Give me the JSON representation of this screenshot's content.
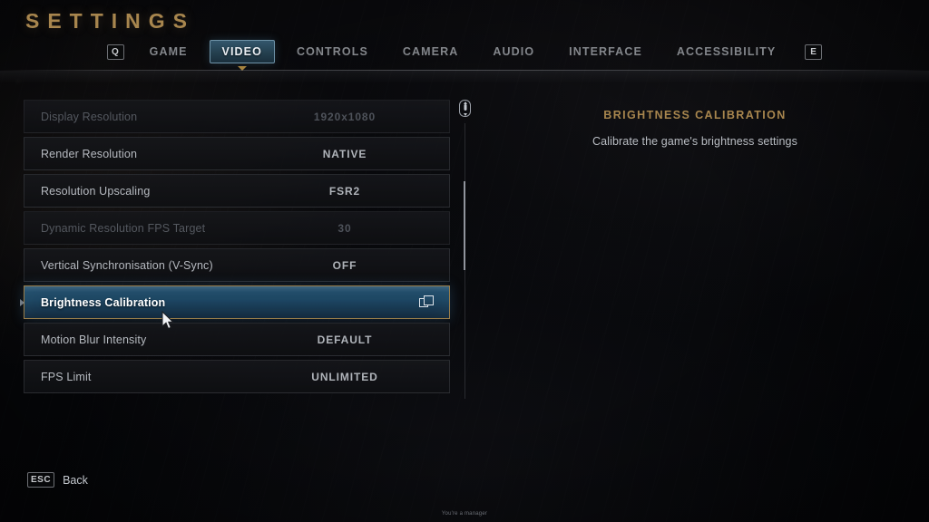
{
  "header": {
    "title": "SETTINGS"
  },
  "tabs": {
    "prev_key": "Q",
    "next_key": "E",
    "items": [
      {
        "label": "GAME",
        "active": false
      },
      {
        "label": "VIDEO",
        "active": true
      },
      {
        "label": "CONTROLS",
        "active": false
      },
      {
        "label": "CAMERA",
        "active": false
      },
      {
        "label": "AUDIO",
        "active": false
      },
      {
        "label": "INTERFACE",
        "active": false
      },
      {
        "label": "ACCESSIBILITY",
        "active": false
      }
    ]
  },
  "settings": {
    "rows": [
      {
        "label": "Display Resolution",
        "value": "1920x1080",
        "disabled": true,
        "selected": false,
        "icon": null
      },
      {
        "label": "Render Resolution",
        "value": "NATIVE",
        "disabled": false,
        "selected": false,
        "icon": null
      },
      {
        "label": "Resolution Upscaling",
        "value": "FSR2",
        "disabled": false,
        "selected": false,
        "icon": null
      },
      {
        "label": "Dynamic Resolution FPS Target",
        "value": "30",
        "disabled": true,
        "selected": false,
        "icon": null
      },
      {
        "label": "Vertical Synchronisation (V-Sync)",
        "value": "OFF",
        "disabled": false,
        "selected": false,
        "icon": null
      },
      {
        "label": "Brightness Calibration",
        "value": "",
        "disabled": false,
        "selected": true,
        "icon": "popup-window-icon"
      },
      {
        "label": "Motion Blur Intensity",
        "value": "DEFAULT",
        "disabled": false,
        "selected": false,
        "icon": null
      },
      {
        "label": "FPS Limit",
        "value": "UNLIMITED",
        "disabled": false,
        "selected": false,
        "icon": null
      }
    ]
  },
  "scrollbar": {
    "icon": "mouse-wheel-icon"
  },
  "detail": {
    "title": "BRIGHTNESS CALIBRATION",
    "description": "Calibrate the game's brightness settings"
  },
  "footer": {
    "key": "ESC",
    "label": "Back"
  },
  "toast": {
    "text": "You're a manager"
  },
  "colors": {
    "accent_gold": "#a8864e",
    "selection_blue": "#1d4662",
    "selection_border": "#9a7e4a",
    "text_primary": "#b6bac0",
    "text_disabled": "#54585f",
    "background": "#06070b"
  }
}
